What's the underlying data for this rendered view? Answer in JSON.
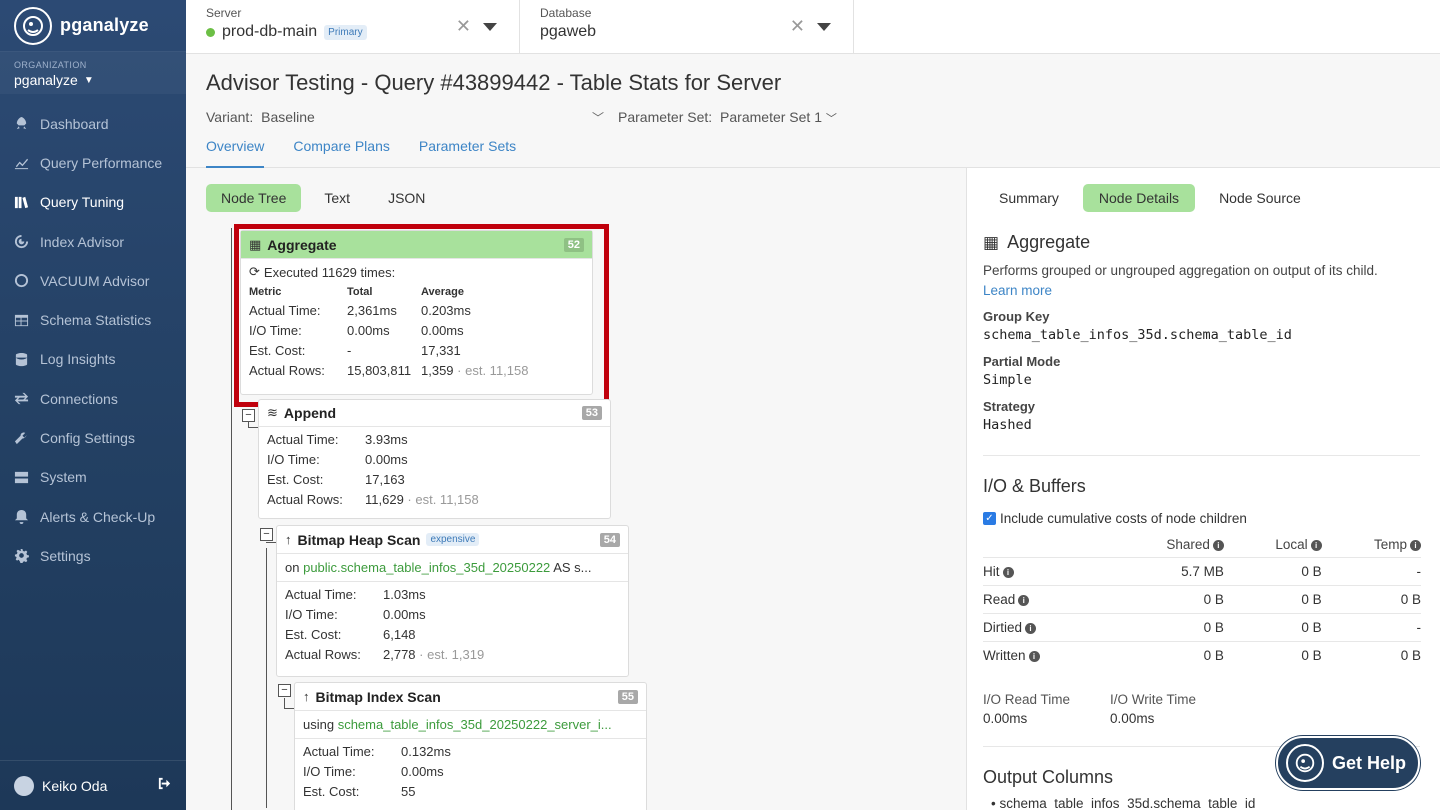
{
  "app": {
    "name": "pganalyze"
  },
  "org": {
    "label": "ORGANIZATION",
    "name": "pganalyze"
  },
  "nav": [
    {
      "label": "Dashboard",
      "icon": "rocket-icon"
    },
    {
      "label": "Query Performance",
      "icon": "chart-icon"
    },
    {
      "label": "Query Tuning",
      "icon": "library-icon",
      "active": true
    },
    {
      "label": "Index Advisor",
      "icon": "index-icon"
    },
    {
      "label": "VACUUM Advisor",
      "icon": "circle-icon"
    },
    {
      "label": "Schema Statistics",
      "icon": "table-icon"
    },
    {
      "label": "Log Insights",
      "icon": "database-icon"
    },
    {
      "label": "Connections",
      "icon": "exchange-icon"
    },
    {
      "label": "Config Settings",
      "icon": "wrench-icon"
    },
    {
      "label": "System",
      "icon": "server-icon"
    },
    {
      "label": "Alerts & Check-Up",
      "icon": "bell-icon"
    },
    {
      "label": "Settings",
      "icon": "gear-icon"
    }
  ],
  "user": {
    "name": "Keiko Oda"
  },
  "server": {
    "label": "Server",
    "value": "prod-db-main",
    "badge": "Primary"
  },
  "database": {
    "label": "Database",
    "value": "pgaweb"
  },
  "page": {
    "title": "Advisor Testing - Query #43899442 - Table Stats for Server",
    "variant_label": "Variant:",
    "variant_value": "Baseline",
    "param_label": "Parameter Set:",
    "param_value": "Parameter Set 1",
    "tabs": [
      "Overview",
      "Compare Plans",
      "Parameter Sets"
    ]
  },
  "view_toggle": [
    "Node Tree",
    "Text",
    "JSON"
  ],
  "nodes": {
    "aggregate": {
      "title": "Aggregate",
      "num": "52",
      "executed": "Executed 11629 times:",
      "headers": [
        "Metric",
        "Total",
        "Average"
      ],
      "rows": [
        [
          "Actual Time:",
          "2,361ms",
          "0.203ms"
        ],
        [
          "I/O Time:",
          "0.00ms",
          "0.00ms"
        ],
        [
          "Est. Cost:",
          "-",
          "17,331"
        ],
        [
          "Actual Rows:",
          "15,803,811",
          "1,359"
        ]
      ],
      "est": "· est. 11,158"
    },
    "append": {
      "title": "Append",
      "num": "53",
      "rows": [
        [
          "Actual Time:",
          "3.93ms"
        ],
        [
          "I/O Time:",
          "0.00ms"
        ],
        [
          "Est. Cost:",
          "17,163"
        ],
        [
          "Actual Rows:",
          "11,629"
        ]
      ],
      "est": "· est. 11,158"
    },
    "heap": {
      "title": "Bitmap Heap Scan",
      "badge": "expensive",
      "num": "54",
      "on_prefix": "on",
      "on_table": "public.schema_table_infos_35d_20250222",
      "on_suffix": "AS s...",
      "rows": [
        [
          "Actual Time:",
          "1.03ms"
        ],
        [
          "I/O Time:",
          "0.00ms"
        ],
        [
          "Est. Cost:",
          "6,148"
        ],
        [
          "Actual Rows:",
          "2,778"
        ]
      ],
      "est": "· est. 1,319"
    },
    "index": {
      "title": "Bitmap Index Scan",
      "num": "55",
      "using_prefix": "using",
      "using_index": "schema_table_infos_35d_20250222_server_i...",
      "rows": [
        [
          "Actual Time:",
          "0.132ms"
        ],
        [
          "I/O Time:",
          "0.00ms"
        ],
        [
          "Est. Cost:",
          "55"
        ]
      ]
    }
  },
  "detail": {
    "tabs": [
      "Summary",
      "Node Details",
      "Node Source"
    ],
    "title": "Aggregate",
    "description": "Performs grouped or ungrouped aggregation on output of its child.",
    "learn_more": "Learn more",
    "group_key_label": "Group Key",
    "group_key": "schema_table_infos_35d.schema_table_id",
    "partial_mode_label": "Partial Mode",
    "partial_mode": "Simple",
    "strategy_label": "Strategy",
    "strategy": "Hashed",
    "io_title": "I/O & Buffers",
    "include_label": "Include cumulative costs of node children",
    "cols": [
      "Shared",
      "Local",
      "Temp"
    ],
    "io_rows": [
      [
        "Hit",
        "5.7 MB",
        "0 B",
        "-"
      ],
      [
        "Read",
        "0 B",
        "0 B",
        "0 B"
      ],
      [
        "Dirtied",
        "0 B",
        "0 B",
        "-"
      ],
      [
        "Written",
        "0 B",
        "0 B",
        "0 B"
      ]
    ],
    "read_time_label": "I/O Read Time",
    "read_time": "0.00ms",
    "write_time_label": "I/O Write Time",
    "write_time": "0.00ms",
    "output_title": "Output Columns",
    "output_first": "schema_table_infos_35d.schema_table_id"
  },
  "help": {
    "label": "Get Help"
  }
}
